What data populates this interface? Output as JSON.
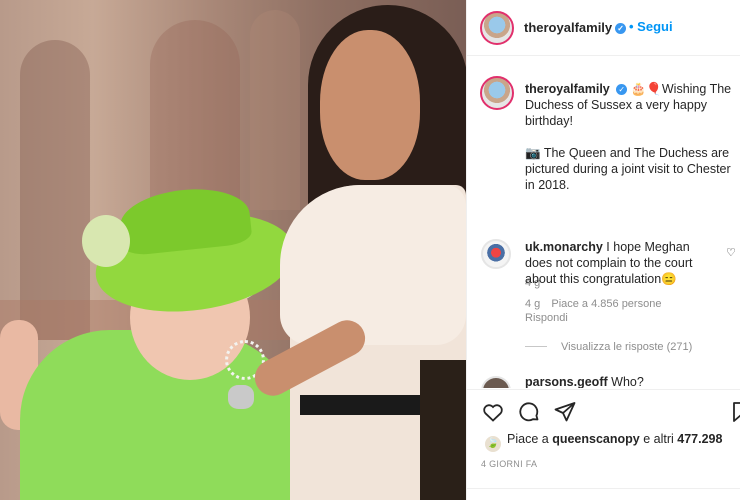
{
  "post": {
    "author": "theroyalfamily",
    "follow_label": "Segui",
    "caption": {
      "author": "theroyalfamily",
      "emoji": "🎂🎈",
      "line1": "Wishing The Duchess of Sussex a very happy birthday!",
      "line2_emoji": "📷",
      "line2": "The Queen and The Duchess are pictured during a joint visit to Chester in 2018.",
      "age": "4 g"
    },
    "comments": [
      {
        "author": "uk.monarchy",
        "text": "I hope Meghan does not complain to the court about this congratulation😑",
        "age": "4 g",
        "likes": "Piace a 4.856 persone",
        "reply_label": "Rispondi",
        "replies_label": "Visualizza le risposte (271)"
      },
      {
        "author": "parsons.geoff",
        "text": "Who?"
      }
    ],
    "likes": {
      "prefix": "Piace a",
      "user": "queenscanopy",
      "suffix": "e altri",
      "count": "477.298"
    },
    "date": "4 GIORNI FA"
  },
  "icons": {
    "verified": "verified-badge-icon",
    "like": "heart-icon",
    "comment": "comment-bubble-icon",
    "share": "paper-plane-icon",
    "save": "bookmark-icon"
  },
  "colors": {
    "follow": "#0095f6",
    "verified": "#3897f0",
    "muted": "#8e8e8e"
  }
}
